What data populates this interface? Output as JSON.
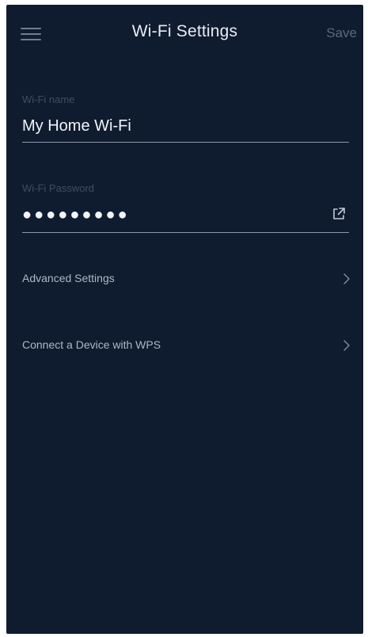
{
  "header": {
    "title": "Wi-Fi Settings",
    "save_label": "Save",
    "menu_icon": "hamburger-menu-icon"
  },
  "wifi_name": {
    "label": "Wi-Fi name",
    "value": "My Home Wi-Fi"
  },
  "wifi_password": {
    "label": "Wi-Fi Password",
    "value": "●●●●●●●●●",
    "share_icon": "share-external-icon"
  },
  "menu": {
    "items": [
      {
        "label": "Advanced Settings",
        "icon": "chevron-right-icon"
      },
      {
        "label": "Connect a Device with WPS",
        "icon": "chevron-right-icon"
      }
    ]
  },
  "colors": {
    "background": "#0f1b2e",
    "title_text": "#e8ecf3",
    "save_disabled": "#5b6880",
    "field_label": "#3f4c63",
    "divider": "#8e98aa"
  }
}
